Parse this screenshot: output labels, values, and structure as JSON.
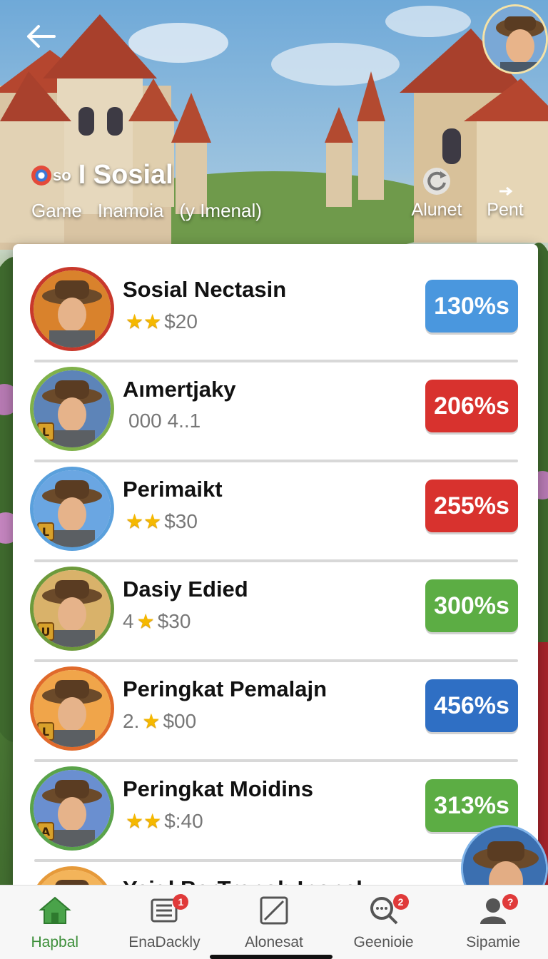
{
  "header": {
    "brand_badge": "so",
    "title": "I Sosial",
    "tabs": [
      "Game",
      "Inamoia",
      "(y Imenal)"
    ],
    "actions": [
      {
        "label": "Alunet",
        "icon": "refresh-icon"
      },
      {
        "label": "Pent",
        "icon": "signal-icon"
      }
    ]
  },
  "list": [
    {
      "name": "Sosial Nectasin",
      "stars": "★★",
      "prefix": "",
      "meta": "$20",
      "value": "130%s",
      "color": "#4a97de",
      "ring": "#c8382b",
      "bg": "#d9822c",
      "badge": ""
    },
    {
      "name": "Aımertjaky",
      "stars": "",
      "prefix": "",
      "meta": "000 4..1",
      "value": "206%s",
      "color": "#d8322e",
      "ring": "#7fb14a",
      "bg": "#5d84b8",
      "badge": "L"
    },
    {
      "name": "Perimaikt",
      "stars": "★★",
      "prefix": "",
      "meta": "$30",
      "value": "255%s",
      "color": "#d8322e",
      "ring": "#5aa0dc",
      "bg": "#6aa6e2",
      "badge": "L"
    },
    {
      "name": "Dasiy Edied",
      "stars": "★",
      "prefix": "4",
      "meta": "$30",
      "value": "300%s",
      "color": "#5cad44",
      "ring": "#6d9a3b",
      "bg": "#d9b26a",
      "badge": "U"
    },
    {
      "name": "Peringkat Pemalajn",
      "stars": "★",
      "prefix": "2.",
      "meta": "$00",
      "value": "456%s",
      "color": "#2f6fc4",
      "ring": "#e06a2b",
      "bg": "#f0a54a",
      "badge": "L"
    },
    {
      "name": "Peringkat Moidins",
      "stars": "★★",
      "prefix": "",
      "meta": "$:40",
      "value": "313%s",
      "color": "#5cad44",
      "ring": "#5aa34a",
      "bg": "#6a8fd0",
      "badge": "A"
    },
    {
      "name": "Yeigl BarTranoh Inonek",
      "stars": "",
      "prefix": "",
      "meta": "",
      "value": "",
      "color": "#2f6fc4",
      "ring": "#e69a3a",
      "bg": "#f3b45a",
      "badge": ""
    }
  ],
  "bottom_nav": [
    {
      "label": "Hapbal",
      "icon": "home-icon",
      "badge": "",
      "active": true
    },
    {
      "label": "EnaDackly",
      "icon": "list-icon",
      "badge": "1",
      "active": false
    },
    {
      "label": "Alonesat",
      "icon": "image-icon",
      "badge": "",
      "active": false
    },
    {
      "label": "Geenioie",
      "icon": "search-chat-icon",
      "badge": "2",
      "active": false
    },
    {
      "label": "Sipamie",
      "icon": "profile-icon",
      "badge": "?",
      "active": false
    }
  ]
}
